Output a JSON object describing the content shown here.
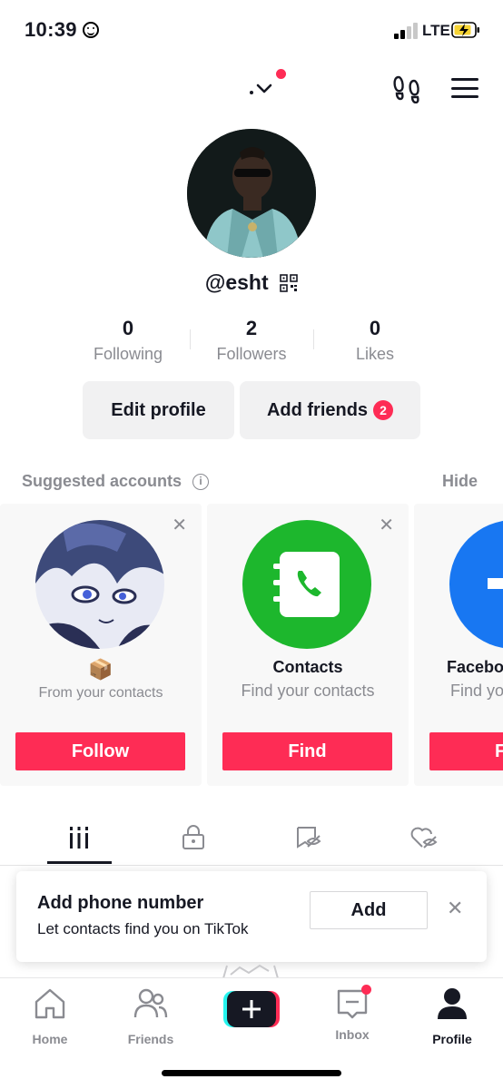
{
  "status_bar": {
    "time": "10:39",
    "network": "LTE"
  },
  "profile": {
    "handle": "@esht",
    "stats": [
      {
        "value": "0",
        "label": "Following"
      },
      {
        "value": "2",
        "label": "Followers"
      },
      {
        "value": "0",
        "label": "Likes"
      }
    ],
    "edit_button": "Edit profile",
    "add_friends_button": "Add friends",
    "add_friends_badge": "2"
  },
  "suggested": {
    "title": "Suggested accounts",
    "hide": "Hide",
    "cards": [
      {
        "name": "",
        "emoji": "📦",
        "subtitle": "From your contacts",
        "button": "Follow"
      },
      {
        "name": "Contacts",
        "subtitle": "Find your contacts",
        "button": "Find"
      },
      {
        "name": "Facebo",
        "subtitle": "Find yo",
        "button": "F"
      }
    ]
  },
  "toast": {
    "title": "Add phone number",
    "subtitle": "Let contacts find you on TikTok",
    "button": "Add"
  },
  "bottom_nav": [
    {
      "label": "Home",
      "icon": "home-icon"
    },
    {
      "label": "Friends",
      "icon": "friends-icon"
    },
    {
      "label": "",
      "icon": "create-icon"
    },
    {
      "label": "Inbox",
      "icon": "inbox-icon"
    },
    {
      "label": "Profile",
      "icon": "profile-icon"
    }
  ],
  "colors": {
    "accent": "#fe2c55",
    "contacts_green": "#1db72d",
    "facebook_blue": "#1877f2",
    "muted": "#8a8b91"
  }
}
